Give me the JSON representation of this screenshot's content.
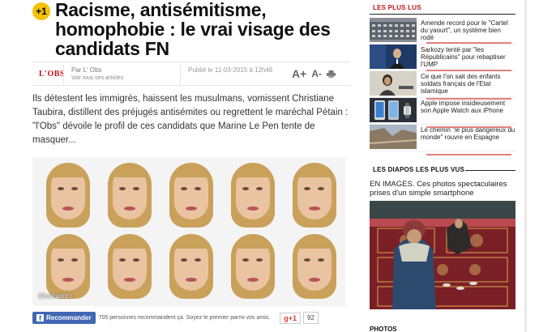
{
  "article": {
    "badge": "+1",
    "headline": "Racisme, antisémitisme, homophobie : le vrai visage des candidats FN",
    "logo": "L'OBS",
    "author": "Par L' Obs",
    "author_link": "Voir tous ses articles",
    "published": "Publié le 11-03-2015 à 12h46",
    "font_larger": "A+",
    "font_smaller": "A-",
    "print_icon": "print-icon",
    "chapo": "Ils détestent les immigrés, haissent les musulmans, vomissent Christiane Taubira, distillent des préjugés antisémites ou regrettent le maréchal Pétain : \"l'Obs\" dévoile le profil de ces candidats que Marine Le Pen tente de masquer...",
    "photo_caption": "(Illustration)"
  },
  "social": {
    "fb_icon": "f",
    "fb_label": "Recommander",
    "fb_text": "705 personnes recommandent ça. Soyez le premier parmi vos amis.",
    "gplus_label": "g+1",
    "gplus_count": "92"
  },
  "sidebar": {
    "most_read_title": "LES PLUS LUS",
    "most_read": [
      {
        "text": "Amende record pour le \"Cartel du yaourt\", un système bien rodé",
        "thumb": "building"
      },
      {
        "text": "Sarkozy tenté par \"les Républicains\" pour rebaptiser l'UMP",
        "thumb": "speaker"
      },
      {
        "text": "Ce que l'on sait des enfants soldats français de l'Etat islamique",
        "thumb": "child"
      },
      {
        "text": "Apple impose insidieusement son Apple Watch aux iPhone",
        "thumb": "watch"
      },
      {
        "text": "Le chemin \"le plus dangereux du monde\" rouvre en Espagne",
        "thumb": "cliff"
      }
    ],
    "diapo_title": "LES DIAPOS LES PLUS VUS",
    "diapo_caption": "EN IMAGES. Ces photos spectaculaires prises d'un simple smartphone",
    "bottom_label": "PHOTOS"
  },
  "colors": {
    "accent": "#c0141b",
    "badge": "#f5c200",
    "facebook": "#4267b2"
  }
}
